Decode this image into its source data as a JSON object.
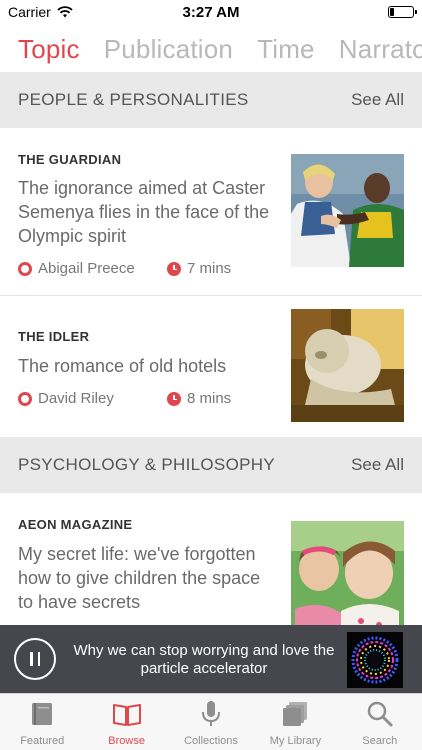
{
  "status_bar": {
    "carrier": "Carrier",
    "time": "3:27 AM",
    "battery_level": 0.2
  },
  "top_tabs": [
    {
      "label": "Topic",
      "active": true
    },
    {
      "label": "Publication",
      "active": false
    },
    {
      "label": "Time",
      "active": false
    },
    {
      "label": "Narrator",
      "active": false
    }
  ],
  "sections": [
    {
      "title": "PEOPLE & PERSONALITIES",
      "see_all": "See All",
      "articles": [
        {
          "publisher": "THE GUARDIAN",
          "headline": "The ignorance aimed at Caster Semenya flies in the face of the Olympic spirit",
          "narrator": "Abigail Preece",
          "duration": "7 mins"
        },
        {
          "publisher": "THE IDLER",
          "headline": "The romance of old hotels",
          "narrator": "David Riley",
          "duration": "8 mins"
        }
      ]
    },
    {
      "title": "PSYCHOLOGY & PHILOSOPHY",
      "see_all": "See All",
      "articles": [
        {
          "publisher": "AEON MAGAZINE",
          "headline": "My secret life: we've forgotten how to give children the space to have secrets"
        }
      ]
    }
  ],
  "player": {
    "title": "Why we can stop worrying and love the particle accelerator"
  },
  "tab_bar": [
    {
      "label": "Featured",
      "icon": "book-closed-icon",
      "active": false
    },
    {
      "label": "Browse",
      "icon": "book-open-icon",
      "active": true
    },
    {
      "label": "Collections",
      "icon": "microphone-icon",
      "active": false
    },
    {
      "label": "My Library",
      "icon": "stack-icon",
      "active": false
    },
    {
      "label": "Search",
      "icon": "search-icon",
      "active": false
    }
  ],
  "colors": {
    "accent": "#e0474c",
    "section_bg": "#e9e9e9",
    "player_bg": "#45474c"
  }
}
